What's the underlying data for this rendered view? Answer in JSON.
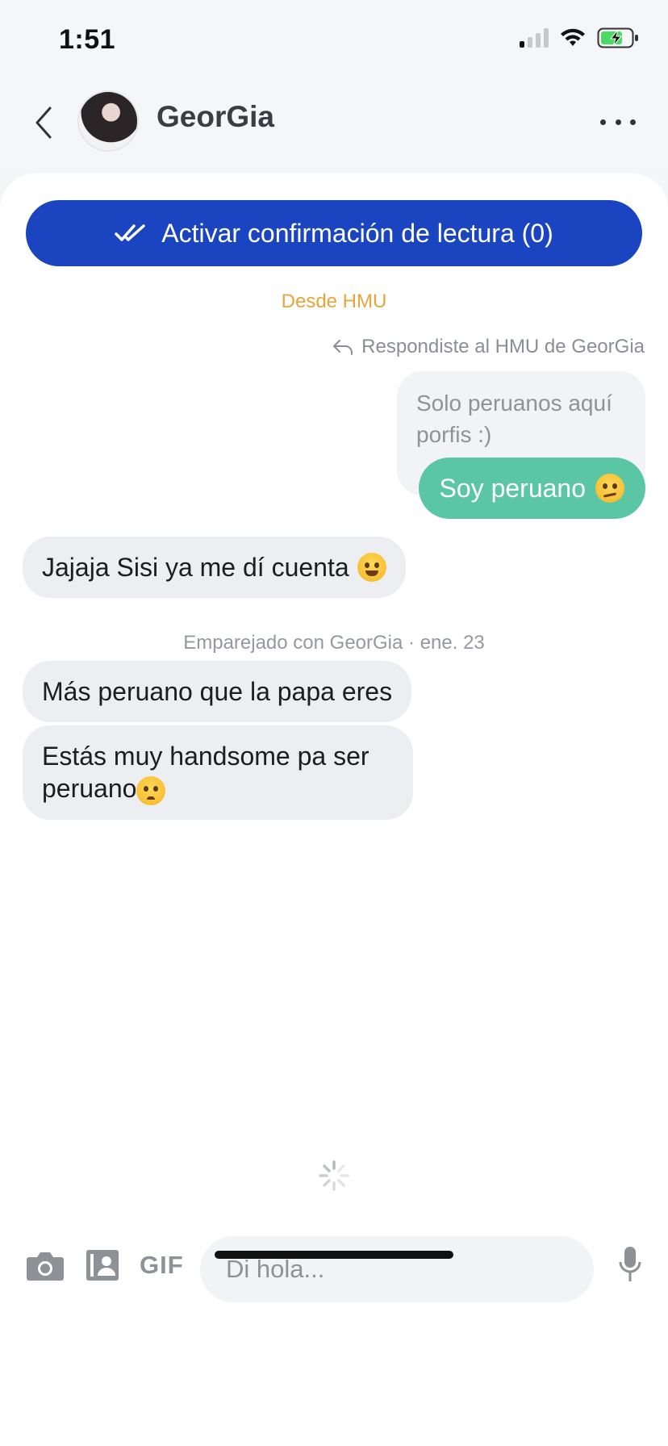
{
  "status_bar": {
    "time": "1:51"
  },
  "header": {
    "contact_name": "GeorGia"
  },
  "read_receipts": {
    "label": "Activar confirmación de lectura (0)"
  },
  "conversation": {
    "source_label": "Desde HMU",
    "reply_note": "Respondiste al HMU de GeorGia",
    "quoted_text": "Solo peruanos aquí porfis :)",
    "sent_message": "Soy peruano",
    "received_message_1": "Jajaja Sisi ya me dí cuenta",
    "match_note": "Emparejado con GeorGia · ene. 23",
    "received_message_2": "Más peruano que la papa eres",
    "received_message_3": "Estás muy handsome pa ser peruano"
  },
  "composer": {
    "gif_label": "GIF",
    "placeholder": "Di hola..."
  },
  "icons": {
    "back": "chevron-left-icon",
    "more": "more-horizontal-icon",
    "double_check": "double-check-icon",
    "reply": "reply-arrow-icon",
    "camera": "camera-icon",
    "contact_card": "contact-card-icon",
    "microphone": "microphone-icon",
    "loading": "spinner-icon"
  },
  "colors": {
    "accent_blue": "#1b44c1",
    "sent_bubble": "#5bc6a3",
    "received_bubble": "#eceef1",
    "source_label": "#e8a63a"
  }
}
